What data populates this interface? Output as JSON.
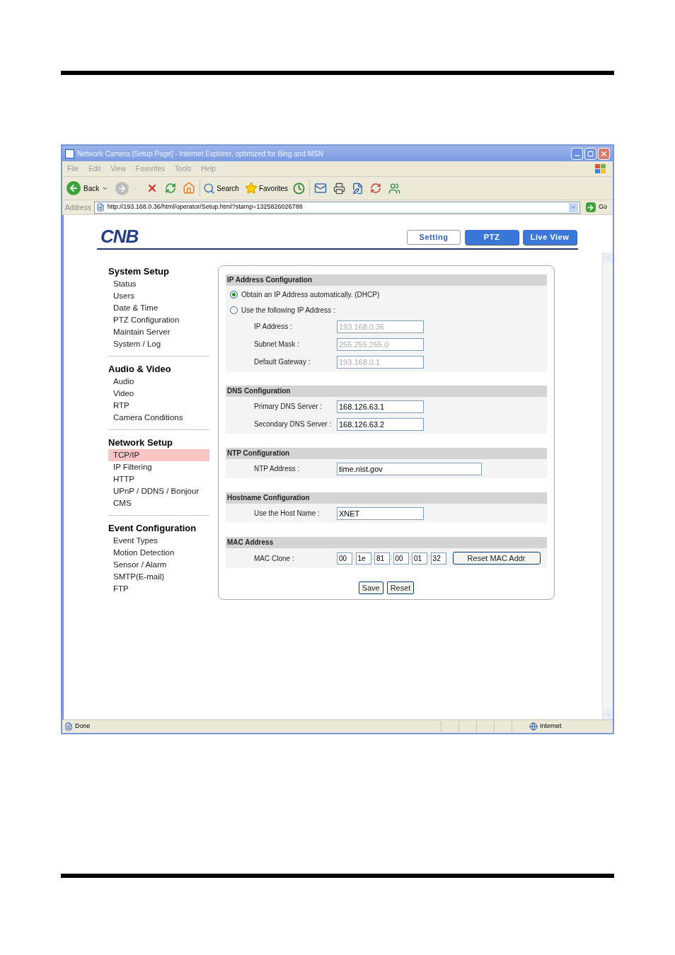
{
  "window": {
    "title": "Network Camera [Setup Page] - Internet Explorer, optimized for Bing and MSN"
  },
  "menu_bar": [
    "File",
    "Edit",
    "View",
    "Favorites",
    "Tools",
    "Help"
  ],
  "toolbar": {
    "back": "Back",
    "search": "Search",
    "favorites": "Favorites"
  },
  "address_bar": {
    "label": "Address",
    "url": "http://193.168.0.36/html/operator/Setup.html?stamp=1325826026788",
    "go": "Go"
  },
  "logo": "CNB",
  "tabs": [
    {
      "label": "Setting",
      "selected": true
    },
    {
      "label": "PTZ",
      "selected": false
    },
    {
      "label": "Live View",
      "selected": false
    }
  ],
  "sidebar": {
    "sections": [
      {
        "title": "System Setup",
        "items": [
          {
            "label": "Status",
            "selected": false
          },
          {
            "label": "Users",
            "selected": false
          },
          {
            "label": "Date & Time",
            "selected": false
          },
          {
            "label": "PTZ Configuration",
            "selected": false
          },
          {
            "label": "Maintain Server",
            "selected": false
          },
          {
            "label": "System / Log",
            "selected": false
          }
        ]
      },
      {
        "title": "Audio & Video",
        "items": [
          {
            "label": "Audio",
            "selected": false
          },
          {
            "label": "Video",
            "selected": false
          },
          {
            "label": "RTP",
            "selected": false
          },
          {
            "label": "Camera Conditions",
            "selected": false
          }
        ]
      },
      {
        "title": "Network Setup",
        "items": [
          {
            "label": "TCP/IP",
            "selected": true
          },
          {
            "label": "IP Filtering",
            "selected": false
          },
          {
            "label": "HTTP",
            "selected": false
          },
          {
            "label": "UPnP / DDNS / Bonjour",
            "selected": false
          },
          {
            "label": "CMS",
            "selected": false
          }
        ]
      },
      {
        "title": "Event Configuration",
        "items": [
          {
            "label": "Event Types",
            "selected": false
          },
          {
            "label": "Motion Detection",
            "selected": false
          },
          {
            "label": "Sensor / Alarm",
            "selected": false
          },
          {
            "label": "SMTP(E-mail)",
            "selected": false
          },
          {
            "label": "FTP",
            "selected": false
          }
        ]
      }
    ]
  },
  "form": {
    "sections": [
      {
        "kind": "ip",
        "title": "IP Address Configuration",
        "radios": [
          {
            "label": "Obtain an IP Address automatically. (DHCP)",
            "selected": true
          },
          {
            "label": "Use the following IP Address :",
            "selected": false
          }
        ],
        "fields": [
          {
            "label": "IP Address :",
            "value": "193.168.0.36",
            "disabled": true
          },
          {
            "label": "Subnet Mask :",
            "value": "255.255.255.0",
            "disabled": true
          },
          {
            "label": "Default Gateway :",
            "value": "193.168.0.1",
            "disabled": true
          }
        ]
      },
      {
        "kind": "dns",
        "title": "DNS Configuration",
        "fields": [
          {
            "label": "Primary DNS Server :",
            "value": "168.126.63.1",
            "disabled": false
          },
          {
            "label": "Secondary DNS Server :",
            "value": "168.126.63.2",
            "disabled": false
          }
        ]
      },
      {
        "kind": "ntp",
        "title": "NTP Configuration",
        "fields": [
          {
            "label": "NTP Address :",
            "value": "time.nist.gov",
            "disabled": false
          }
        ]
      },
      {
        "kind": "hostname",
        "title": "Hostname Configuration",
        "fields": [
          {
            "label": "Use the Host Name :",
            "value": "XNET",
            "disabled": false
          }
        ]
      },
      {
        "kind": "mac",
        "title": "MAC Address",
        "mac": {
          "label": "MAC Clone :",
          "octets": [
            "00",
            "1e",
            "81",
            "00",
            "01",
            "32"
          ],
          "separator": ":",
          "button": "Reset MAC Addr"
        }
      }
    ],
    "buttons": [
      "Save",
      "Reset"
    ]
  },
  "status_bar": {
    "status": "Done",
    "zone": "Internet"
  }
}
